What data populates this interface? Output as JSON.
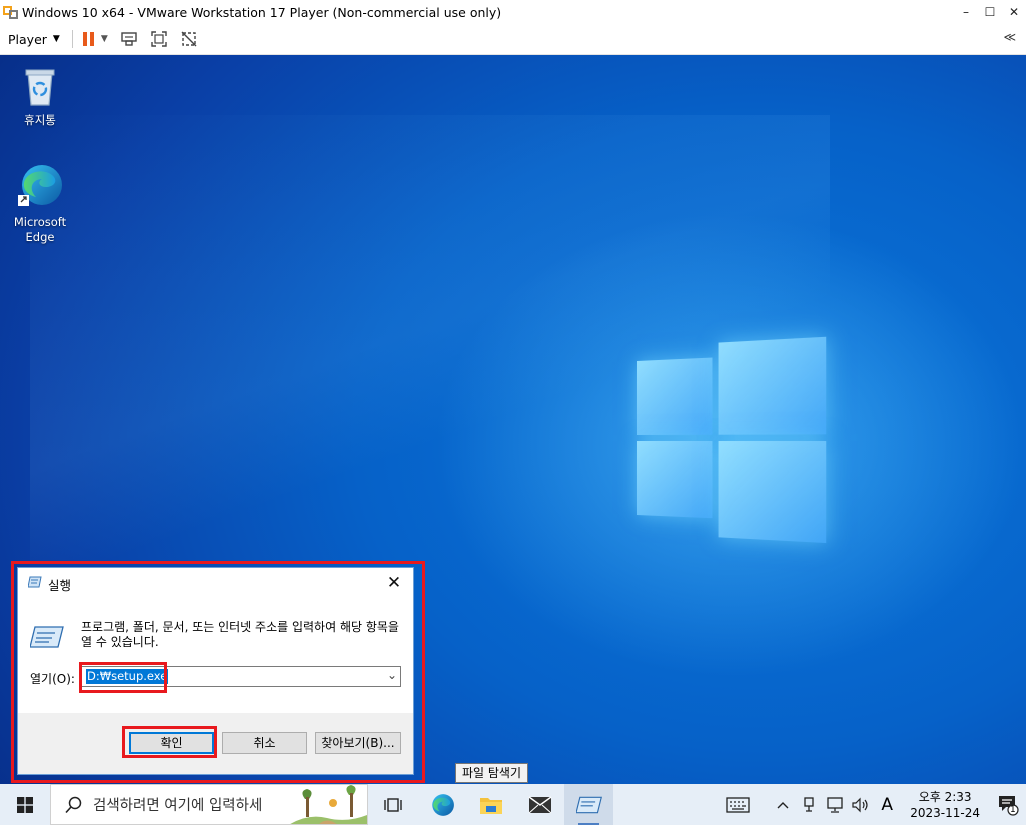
{
  "vm": {
    "title": "Windows 10 x64 - VMware Workstation 17 Player (Non-commercial use only)",
    "controls": {
      "minimize": "–",
      "maximize": "☐",
      "close": "✕"
    },
    "toolbar": {
      "player_label": "Player",
      "collapse": "≪"
    }
  },
  "desktop": {
    "icons": [
      {
        "label": "휴지통",
        "icon": "recycle-bin-icon"
      },
      {
        "label": "Microsoft Edge",
        "icon": "edge-icon"
      }
    ]
  },
  "run_dialog": {
    "title": "실행",
    "close": "✕",
    "description": "프로그램, 폴더, 문서, 또는 인터넷 주소를 입력하여 해당 항목을 열 수 있습니다.",
    "open_label": "열기(O):",
    "input_value": "D:₩setup.exe",
    "buttons": {
      "ok": "확인",
      "cancel": "취소",
      "browse": "찾아보기(B)..."
    }
  },
  "tooltip": "파일 탐색기",
  "taskbar": {
    "search_placeholder": "검색하려면 여기에 입력하세",
    "apps": [
      "task-view-icon",
      "edge-icon",
      "file-explorer-icon",
      "mail-icon",
      "run-icon"
    ],
    "tray": {
      "ime": "A",
      "time": "오후 2:33",
      "date": "2023-11-24",
      "notification_count": "1"
    }
  },
  "colors": {
    "accent": "#0078d7",
    "annotation": "#e8191e",
    "desktop_blue": "#0661c8"
  }
}
